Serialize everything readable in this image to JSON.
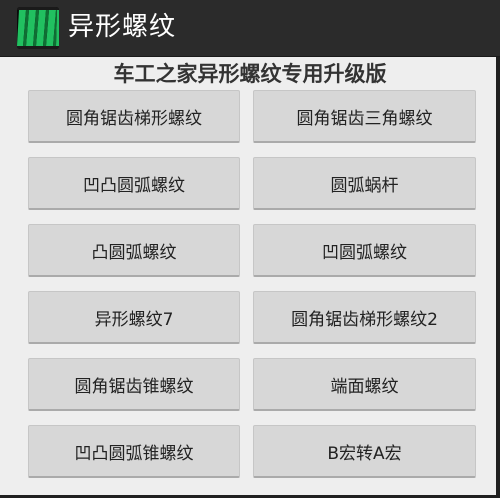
{
  "app_bar": {
    "title": "异形螺纹",
    "icon_name": "thread-screw-icon",
    "background": "#2b2b2b",
    "icon_color": "#21c060"
  },
  "main": {
    "headline": "车工之家异形螺纹专用升级版",
    "buttons": [
      {
        "label": "圆角锯齿梯形螺纹"
      },
      {
        "label": "圆角锯齿三角螺纹"
      },
      {
        "label": "凹凸圆弧螺纹"
      },
      {
        "label": "圆弧蜗杆"
      },
      {
        "label": "凸圆弧螺纹"
      },
      {
        "label": "凹圆弧螺纹"
      },
      {
        "label": "异形螺纹7"
      },
      {
        "label": "圆角锯齿梯形螺纹2"
      },
      {
        "label": "圆角锯齿锥螺纹"
      },
      {
        "label": "端面螺纹"
      },
      {
        "label": "凹凸圆弧锥螺纹"
      },
      {
        "label": "B宏转A宏"
      }
    ]
  }
}
